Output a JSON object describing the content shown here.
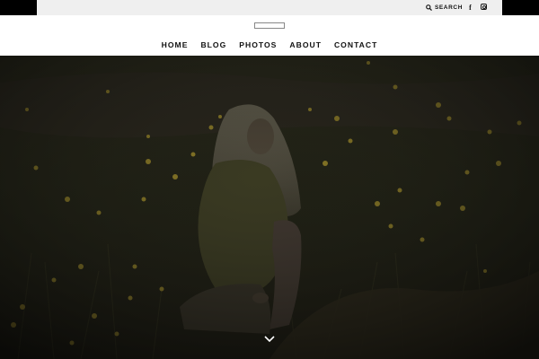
{
  "topbar": {
    "search_label": "SEARCH",
    "search_icon": "search-icon",
    "facebook_icon": "facebook-icon",
    "instagram_icon": "instagram-icon"
  },
  "logo": {
    "icon": "site-logo"
  },
  "nav": {
    "items": [
      {
        "label": "HOME"
      },
      {
        "label": "BLOG"
      },
      {
        "label": "PHOTOS"
      },
      {
        "label": "ABOUT"
      },
      {
        "label": "CONTACT"
      }
    ]
  },
  "hero": {
    "image": "woman-sitting-in-wildflower-field",
    "overlay_color": "#000000",
    "scroll_icon": "chevron-down-icon"
  },
  "colors": {
    "topbar_bg": "#efefef",
    "header_bg": "#ffffff",
    "text": "#111111",
    "flower_yellow": "#c9b03a",
    "scroll_chevron": "#ffffff"
  }
}
